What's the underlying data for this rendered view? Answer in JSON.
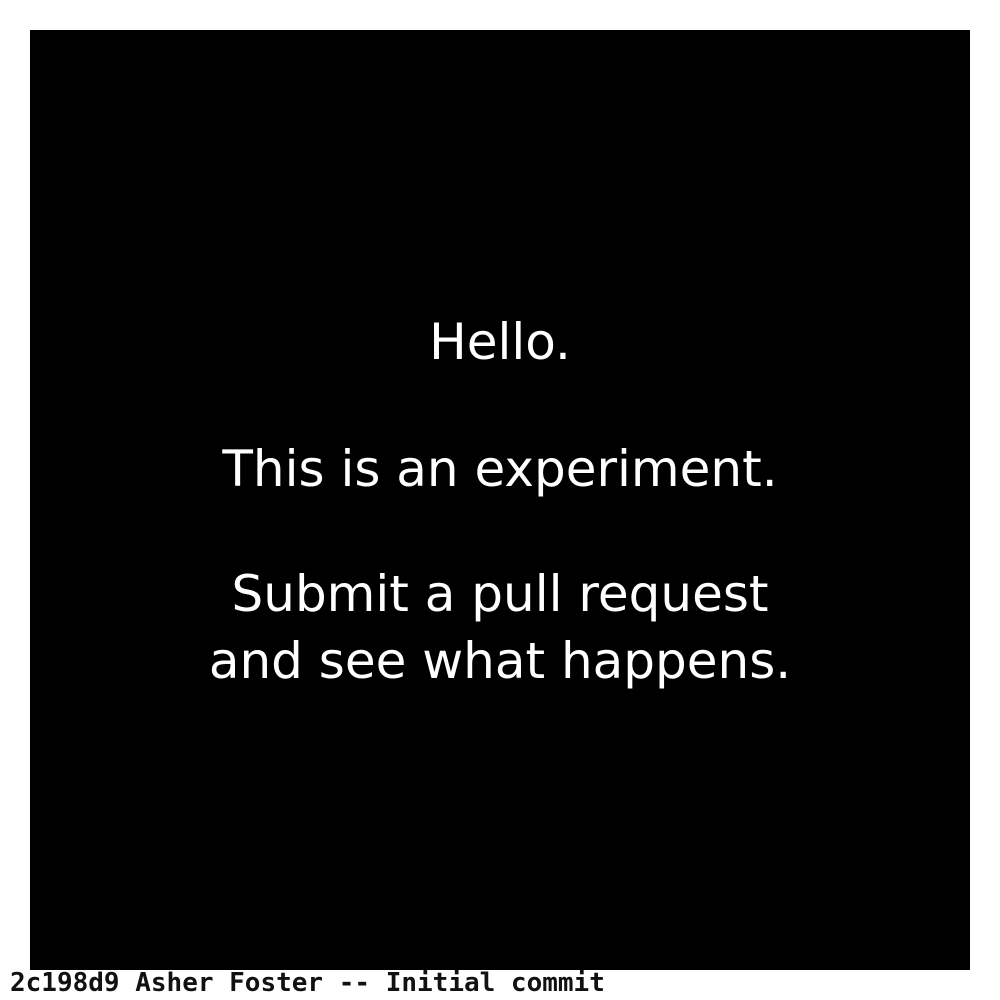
{
  "panel": {
    "background": "#000000",
    "text_color": "#ffffff",
    "lines": [
      "Hello.",
      "This is an experiment.",
      "Submit a pull request",
      "and see what happens."
    ]
  },
  "footer": {
    "commit_hash": "2c198d9",
    "author": "Asher Foster",
    "separator": "--",
    "message": "Initial commit"
  }
}
